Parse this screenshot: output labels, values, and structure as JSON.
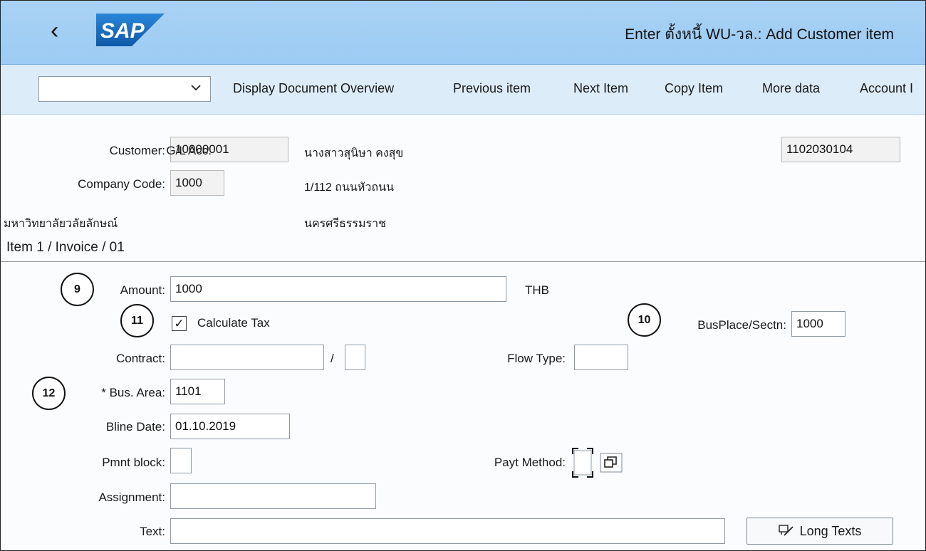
{
  "header": {
    "back_icon": "chevron-left",
    "logo_text": "SAP",
    "title": "Enter ตั้งหนี้ WU-วล.: Add Customer item"
  },
  "toolbar": {
    "dropdown_value": "",
    "buttons": [
      "Display Document Overview",
      "Previous item",
      "Next Item",
      "Copy Item",
      "More data",
      "Account I"
    ]
  },
  "customer_block": {
    "customer_label": "Customer:",
    "customer_value": "10000001",
    "customer_name": "นางสาวสุนิษา คงสุข",
    "company_code_label": "Company Code:",
    "company_code_value": "1000",
    "address_line": "1/112 ถนนหัวถนน",
    "company_name": "มหาวิทยาลัยวลัยลักษณ์",
    "city": "นครศรีธรรมราช",
    "gl_acc_label": "G/L Acc:",
    "gl_acc_value": "1102030104"
  },
  "item_section": {
    "title": "Item 1 / Invoice / 01",
    "amount_label": "Amount:",
    "amount_value": "1000",
    "currency": "THB",
    "calculate_tax_label": "Calculate Tax",
    "calculate_tax_checked": true,
    "check_mark": "✓",
    "busplace_label": "BusPlace/Sectn:",
    "busplace_value": "1000",
    "contract_label": "Contract:",
    "contract_value": "",
    "contract_separator": "/",
    "contract_sub_value": "",
    "flow_type_label": "Flow Type:",
    "flow_type_value": "",
    "bus_area_required": "*",
    "bus_area_label": "Bus. Area:",
    "bus_area_value": "1101",
    "bline_date_label": "Bline Date:",
    "bline_date_value": "01.10.2019",
    "pmnt_block_label": "Pmnt block:",
    "pmnt_block_value": "",
    "payt_method_label": "Payt Method:",
    "payt_method_value": "",
    "assignment_label": "Assignment:",
    "assignment_value": "",
    "text_label": "Text:",
    "text_value": "",
    "long_texts_label": "Long Texts"
  },
  "markers": [
    "9",
    "10",
    "11",
    "12"
  ],
  "colors": {
    "titlebar": "#a9d2f5",
    "toolbar": "#dcecf9",
    "logo_blue": "#1c6fc5"
  }
}
